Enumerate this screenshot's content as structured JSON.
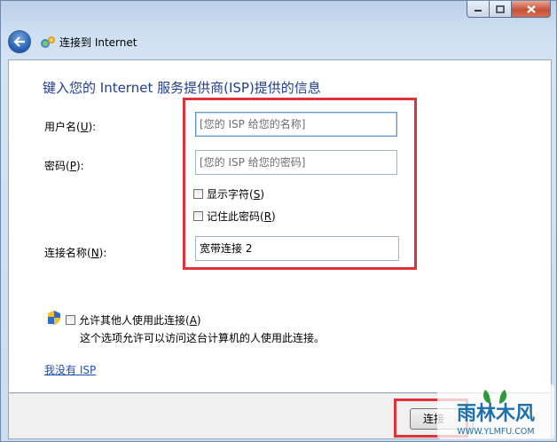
{
  "window": {
    "title": "连接到 Internet"
  },
  "heading": "键入您的 Internet 服务提供商(ISP)提供的信息",
  "fields": {
    "username": {
      "label_pre": "用户名(",
      "label_key": "U",
      "label_post": "):",
      "placeholder": "[您的 ISP 给您的名称]"
    },
    "password": {
      "label_pre": "密码(",
      "label_key": "P",
      "label_post": "):",
      "placeholder": "[您的 ISP 给您的密码]"
    },
    "connection_name": {
      "label_pre": "连接名称(",
      "label_key": "N",
      "label_post": "):",
      "value": "宽带连接 2"
    }
  },
  "checkboxes": {
    "show_chars": {
      "label_pre": "显示字符(",
      "key": "S",
      "label_post": ")",
      "checked": false
    },
    "remember": {
      "label_pre": "记住此密码(",
      "key": "R",
      "label_post": ")",
      "checked": false
    },
    "allow_others": {
      "label_pre": "允许其他人使用此连接(",
      "key": "A",
      "label_post": ")",
      "checked": false,
      "description": "这个选项允许可以访问这台计算机的人使用此连接。"
    }
  },
  "no_isp_link": "我没有 ISP",
  "footer": {
    "connect_label": "连接"
  },
  "watermark": {
    "text": "雨林木风",
    "url": "WWW.YLMFU.COM"
  },
  "icons": [
    "back-arrow-icon",
    "network-icon",
    "uac-shield-icon",
    "minimize-icon",
    "maximize-icon",
    "close-icon"
  ],
  "colors": {
    "heading": "#1e3f8f",
    "link": "#1a4fb5",
    "highlight": "#e0323b"
  }
}
